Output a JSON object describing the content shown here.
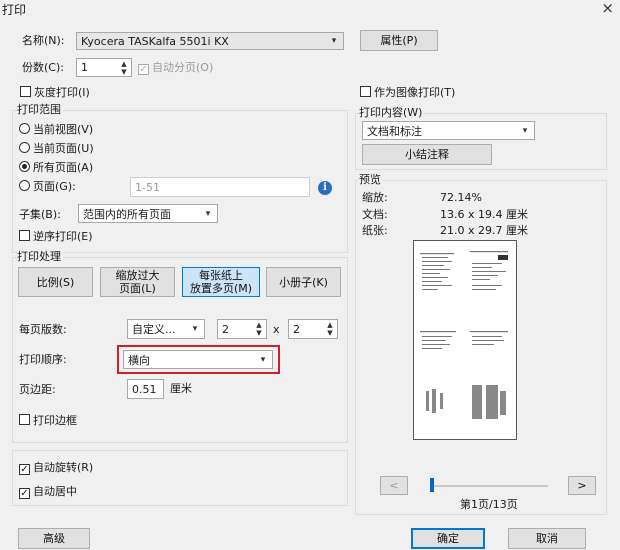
{
  "window": {
    "title": "打印",
    "close_glyph": "×"
  },
  "printer": {
    "label": "名称(N):",
    "name": "Kyocera TASKalfa 5501i KX",
    "properties_button": "属性(P)"
  },
  "copies": {
    "label": "份数(C):",
    "value": "1",
    "collate_label": "自动分页(O)"
  },
  "options": {
    "grayscale_label": "灰度打印(I)",
    "print_as_image_label": "作为图像打印(T)"
  },
  "print_range": {
    "title": "打印范围",
    "current_view": "当前视图(V)",
    "current_page": "当前页面(U)",
    "all_pages": "所有页面(A)",
    "pages_label": "页面(G):",
    "pages_value": "1-51",
    "subset_label": "子集(B):",
    "subset_value": "范围内的所有页面",
    "reverse_label": "逆序打印(E)"
  },
  "print_handling": {
    "title": "打印处理",
    "btn_scale": "比例(S)",
    "btn_shrink": "缩放过大\n页面(L)",
    "btn_multiple": "每张纸上\n放置多页(M)",
    "btn_booklet": "小册子(K)",
    "pages_per_sheet_label": "每页版数:",
    "pages_per_sheet_value": "自定义...",
    "cols_value": "2",
    "times": "x",
    "rows_value": "2",
    "order_label": "打印顺序:",
    "order_value": "横向",
    "margin_label": "页边距:",
    "margin_value": "0.51",
    "margin_unit": "厘米",
    "border_label": "打印边框"
  },
  "auto": {
    "rotate_label": "自动旋转(R)",
    "center_label": "自动居中"
  },
  "print_content": {
    "title": "打印内容(W)",
    "value": "文档和标注",
    "summarize_button": "小结注释"
  },
  "preview": {
    "title": "预览",
    "zoom_label": "缩放:",
    "zoom_value": "72.14%",
    "doc_label": "文档:",
    "doc_value": "13.6 x 19.4 厘米",
    "paper_label": "纸张:",
    "paper_value": "21.0 x 29.7 厘米",
    "page_indicator": "第1页/13页",
    "slider_position": 0.02
  },
  "footer": {
    "advanced_button": "高级",
    "ok_button": "确定",
    "cancel_button": "取消"
  },
  "icons": {
    "dropdown": "▾",
    "spin_up": "▲",
    "spin_down": "▼",
    "check": "✓",
    "info": "i",
    "prev": "<",
    "next": ">"
  }
}
